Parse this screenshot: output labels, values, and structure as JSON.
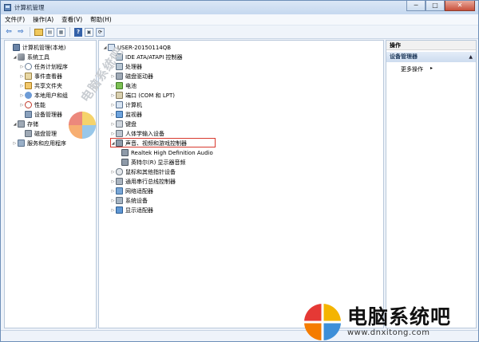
{
  "window": {
    "title": "计算机管理",
    "min": "─",
    "max": "□",
    "close": "✕"
  },
  "menu": [
    "文件(F)",
    "操作(A)",
    "查看(V)",
    "帮助(H)"
  ],
  "toolbar": {
    "back": "⇦",
    "forward": "⇨",
    "help": "?"
  },
  "left_tree": [
    {
      "label": "计算机管理(本地)",
      "tri": "",
      "icon": "computer-management-icon"
    },
    {
      "label": "系统工具",
      "tri": "◢",
      "icon": "system-tools-icon"
    },
    {
      "label": "任务计划程序",
      "tri": "▷",
      "icon": "task-scheduler-icon"
    },
    {
      "label": "事件查看器",
      "tri": "▷",
      "icon": "event-viewer-icon"
    },
    {
      "label": "共享文件夹",
      "tri": "▷",
      "icon": "shared-folders-icon"
    },
    {
      "label": "本地用户和组",
      "tri": "▷",
      "icon": "local-users-icon"
    },
    {
      "label": "性能",
      "tri": "▷",
      "icon": "performance-icon"
    },
    {
      "label": "设备管理器",
      "tri": "",
      "icon": "device-manager-icon"
    },
    {
      "label": "存储",
      "tri": "◢",
      "icon": "storage-icon"
    },
    {
      "label": "磁盘管理",
      "tri": "",
      "icon": "disk-management-icon"
    },
    {
      "label": "服务和应用程序",
      "tri": "▷",
      "icon": "services-icon"
    }
  ],
  "device_tree": [
    {
      "label": "USER-20150114QB",
      "tri": "◢",
      "icon": "computer-icon"
    },
    {
      "label": "IDE ATA/ATAPI 控制器",
      "tri": "▷",
      "icon": "ide-controller-icon"
    },
    {
      "label": "处理器",
      "tri": "▷",
      "icon": "processor-icon"
    },
    {
      "label": "磁盘驱动器",
      "tri": "▷",
      "icon": "disk-drive-icon"
    },
    {
      "label": "电池",
      "tri": "▷",
      "icon": "battery-icon"
    },
    {
      "label": "端口 (COM 和 LPT)",
      "tri": "▷",
      "icon": "port-icon"
    },
    {
      "label": "计算机",
      "tri": "▷",
      "icon": "computer-node-icon"
    },
    {
      "label": "监视器",
      "tri": "▷",
      "icon": "monitor-icon"
    },
    {
      "label": "键盘",
      "tri": "▷",
      "icon": "keyboard-icon"
    },
    {
      "label": "人体学输入设备",
      "tri": "▷",
      "icon": "hid-icon"
    },
    {
      "label": "声音、视频和游戏控制器",
      "tri": "◢",
      "icon": "sound-controller-icon"
    },
    {
      "label": "Realtek High Definition Audio",
      "tri": "",
      "icon": "audio-device-icon"
    },
    {
      "label": "英特尔(R) 显示器音频",
      "tri": "",
      "icon": "audio-device-icon"
    },
    {
      "label": "鼠标和其他指针设备",
      "tri": "▷",
      "icon": "mouse-icon"
    },
    {
      "label": "通用串行总线控制器",
      "tri": "▷",
      "icon": "usb-icon"
    },
    {
      "label": "网络适配器",
      "tri": "▷",
      "icon": "network-adapter-icon"
    },
    {
      "label": "系统设备",
      "tri": "▷",
      "icon": "system-device-icon"
    },
    {
      "label": "显示适配器",
      "tri": "▷",
      "icon": "display-adapter-icon"
    }
  ],
  "actions": {
    "header": "操作",
    "section": "设备管理器",
    "more": "更多操作"
  },
  "watermark": "电脑系统吧",
  "logo": {
    "name": "电脑系统吧",
    "url": "www.dnxitong.com"
  },
  "colors": {
    "highlight_border": "#d8392e",
    "pane_border": "#b9c8da"
  }
}
